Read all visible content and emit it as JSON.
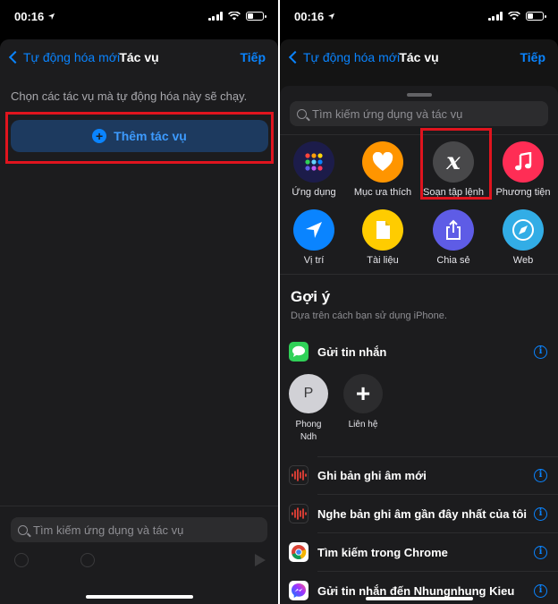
{
  "status": {
    "time": "00:16"
  },
  "left": {
    "nav": {
      "back": "Tự động hóa mới",
      "title": "Tác vụ",
      "next": "Tiếp"
    },
    "instruction": "Chọn các tác vụ mà tự động hóa này sẽ chạy.",
    "add_action": "Thêm tác vụ",
    "search_placeholder": "Tìm kiếm ứng dụng và tác vụ"
  },
  "right": {
    "nav": {
      "back": "Tự động hóa mới",
      "title": "Tác vụ",
      "next": "Tiếp"
    },
    "search_placeholder": "Tìm kiếm ứng dụng và tác vụ",
    "categories": [
      {
        "label": "Ứng dụng",
        "icon": "apps-grid-icon",
        "color": "#1c1c4a"
      },
      {
        "label": "Mục ưa thích",
        "icon": "heart-icon",
        "color": "#ff9500"
      },
      {
        "label": "Soạn tập lệnh",
        "icon": "script-x-icon",
        "color": "#48484a"
      },
      {
        "label": "Phương tiện",
        "icon": "music-note-icon",
        "color": "#ff2d55"
      },
      {
        "label": "Vị trí",
        "icon": "location-arrow-icon",
        "color": "#0a84ff"
      },
      {
        "label": "Tài liệu",
        "icon": "document-icon",
        "color": "#ffcc00"
      },
      {
        "label": "Chia sẻ",
        "icon": "share-icon",
        "color": "#5e5ce6"
      },
      {
        "label": "Web",
        "icon": "compass-icon",
        "color": "#32ade6"
      }
    ],
    "suggestions_title": "Gợi ý",
    "suggestions_subtitle": "Dựa trên cách bạn sử dụng iPhone.",
    "send_message": "Gửi tin nhắn",
    "contacts": [
      {
        "initial": "P",
        "name_line1": "Phong",
        "name_line2": "Ndh"
      },
      {
        "initial": "+",
        "name_line1": "Liên hệ",
        "name_line2": ""
      }
    ],
    "rows": [
      {
        "label": "Ghi bản ghi âm mới",
        "icon": "voice-memo-icon"
      },
      {
        "label": "Nghe bản ghi âm gần đây nhất của tôi",
        "icon": "voice-memo-icon"
      },
      {
        "label": "Tìm kiếm trong Chrome",
        "icon": "chrome-icon"
      },
      {
        "label": "Gửi tin nhắn đến Nhungnhung Kieu",
        "icon": "messenger-icon"
      }
    ]
  }
}
